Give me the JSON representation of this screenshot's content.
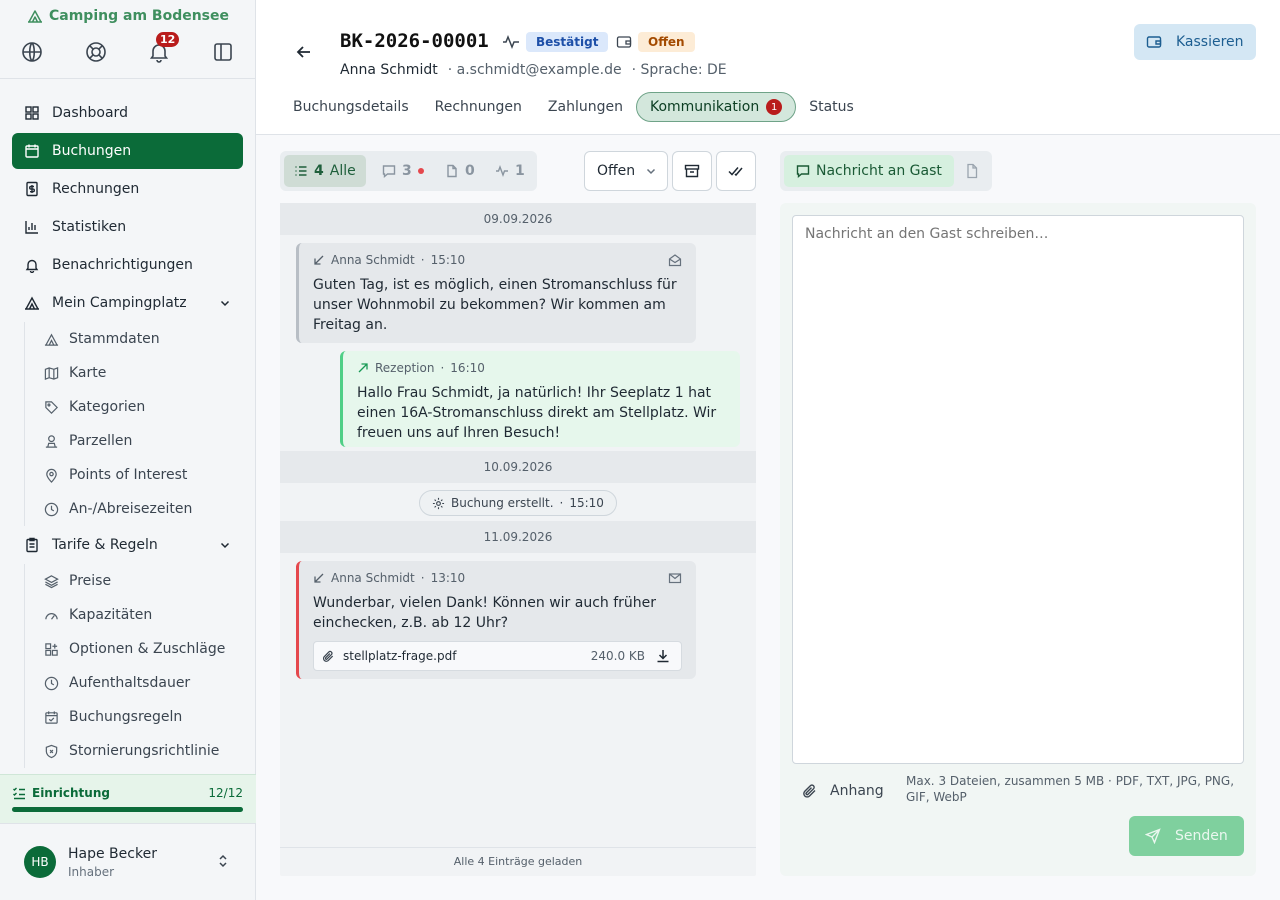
{
  "app": {
    "title": "Camping am Bodensee",
    "notification_count": "12"
  },
  "sidebar": {
    "nav": [
      {
        "label": "Dashboard",
        "icon": "dashboard-icon"
      },
      {
        "label": "Buchungen",
        "icon": "calendar-icon"
      },
      {
        "label": "Rechnungen",
        "icon": "invoice-icon"
      },
      {
        "label": "Statistiken",
        "icon": "chart-icon"
      },
      {
        "label": "Benachrichtigungen",
        "icon": "bell-icon"
      },
      {
        "label": "Mein Campingplatz",
        "icon": "tent-icon"
      }
    ],
    "campsite_items": [
      {
        "label": "Stammdaten",
        "icon": "tent-icon"
      },
      {
        "label": "Karte",
        "icon": "map-icon"
      },
      {
        "label": "Kategorien",
        "icon": "tag-icon"
      },
      {
        "label": "Parzellen",
        "icon": "plot-icon"
      },
      {
        "label": "Points of Interest",
        "icon": "pin-icon"
      },
      {
        "label": "An-/Abreisezeiten",
        "icon": "clock-icon"
      }
    ],
    "tariffs_label": "Tarife & Regeln",
    "tariff_items": [
      {
        "label": "Preise",
        "icon": "layers-icon"
      },
      {
        "label": "Kapazitäten",
        "icon": "gauge-icon"
      },
      {
        "label": "Optionen & Zuschläge",
        "icon": "grid-plus-icon"
      },
      {
        "label": "Aufenthaltsdauer",
        "icon": "clock-icon"
      },
      {
        "label": "Buchungsregeln",
        "icon": "calendar-check-icon"
      },
      {
        "label": "Stornierungsrichtlinie",
        "icon": "shield-icon"
      }
    ],
    "setup": {
      "label": "Einrichtung",
      "count": "12/12",
      "progress": 1.0
    },
    "user": {
      "initials": "HB",
      "name": "Hape Becker",
      "role": "Inhaber"
    }
  },
  "header": {
    "booking_id": "BK-2026-00001",
    "status_confirmed": "Bestätigt",
    "payment_status": "Offen",
    "guest_name": "Anna Schmidt",
    "guest_email": "· a.schmidt@example.de",
    "language": "· Sprache: DE",
    "cash_button": "Kassieren",
    "tabs": [
      "Buchungsdetails",
      "Rechnungen",
      "Zahlungen",
      "Kommunikation",
      "Status"
    ],
    "comm_badge": "1"
  },
  "filters": {
    "all_count": "4",
    "all_label": "Alle",
    "messages_count": "3",
    "files_count": "0",
    "events_count": "1",
    "status_select": "Offen"
  },
  "thread": {
    "dates": [
      "09.09.2026",
      "10.09.2026",
      "11.09.2026"
    ],
    "messages": [
      {
        "sender": "Anna Schmidt",
        "time": "15:10",
        "text": "Guten Tag, ist es möglich, einen Stromanschluss für unser Wohnmobil zu bekommen? Wir kommen am Freitag an."
      },
      {
        "sender": "Rezeption",
        "time": "16:10",
        "text": "Hallo Frau Schmidt, ja natürlich! Ihr Seeplatz 1 hat einen 16A-Stromanschluss direkt am Stellplatz. Wir freuen uns auf Ihren Besuch!"
      },
      {
        "sender": "Anna Schmidt",
        "time": "13:10",
        "text": "Wunderbar, vielen Dank! Können wir auch früher einchecken, z.B. ab 12 Uhr?",
        "attachment": {
          "name": "stellplatz-frage.pdf",
          "size": "240.0 KB"
        }
      }
    ],
    "system_event": {
      "text": "Buchung erstellt.",
      "time": "15:10"
    },
    "sep": "·",
    "footer": "Alle 4 Einträge geladen"
  },
  "compose": {
    "tab_label": "Nachricht an Gast",
    "placeholder": "Nachricht an den Gast schreiben…",
    "attach_label": "Anhang",
    "hint": "Max. 3 Dateien, zusammen 5 MB · PDF, TXT, JPG, PNG, GIF, WebP",
    "send_label": "Senden"
  },
  "colors": {
    "brand": "#0b6b39",
    "accent_blue": "#1d4fa8",
    "alert": "#b91c1c"
  }
}
